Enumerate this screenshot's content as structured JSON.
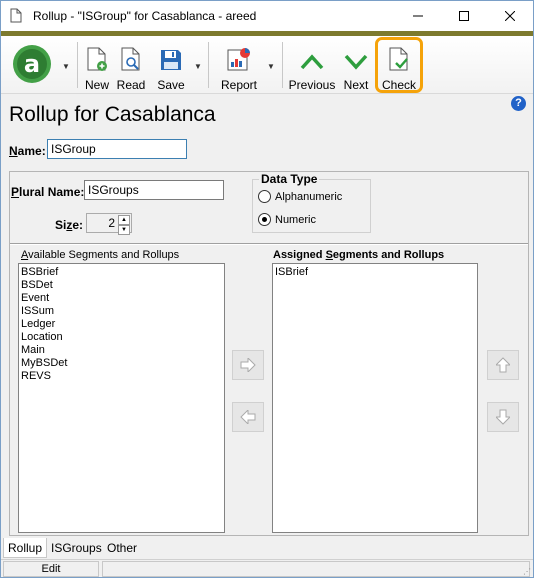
{
  "window": {
    "title": "Rollup - \"ISGroup\" for Casablanca - areed",
    "accent_color": "#7d7a2e"
  },
  "toolbar": {
    "logo_letter": "a",
    "new_label": "New",
    "read_label": "Read",
    "save_label": "Save",
    "report_label": "Report",
    "previous_label": "Previous",
    "next_label": "Next",
    "check_label": "Check",
    "highlight_color": "#f5a30a"
  },
  "page": {
    "title": "Rollup for Casablanca",
    "help_glyph": "?"
  },
  "form": {
    "name_label_u": "N",
    "name_label_rest": "ame:",
    "name_value": "ISGroup",
    "plural_label_u": "P",
    "plural_label_rest": "lural Name:",
    "plural_value": "ISGroups",
    "size_label_pre": "Si",
    "size_label_u": "z",
    "size_label_post": "e:",
    "size_value": "2",
    "data_type": {
      "title": "Data Type",
      "options": [
        "Alphanumeric",
        "Numeric"
      ],
      "selected": "Numeric"
    }
  },
  "segments": {
    "available_label_u": "A",
    "available_label_rest": "vailable Segments and Rollups",
    "available_items": [
      "BSBrief",
      "BSDet",
      "Event",
      "ISSum",
      "Ledger",
      "Location",
      "Main",
      "MyBSDet",
      "REVS"
    ],
    "assigned_label_pre": "Assigned ",
    "assigned_label_u": "S",
    "assigned_label_post": "egments and Rollups",
    "assigned_items": [
      "ISBrief"
    ]
  },
  "tabs": [
    "Rollup",
    "ISGroups",
    "Other"
  ],
  "active_tab": "Rollup",
  "status": {
    "mode": "Edit"
  }
}
